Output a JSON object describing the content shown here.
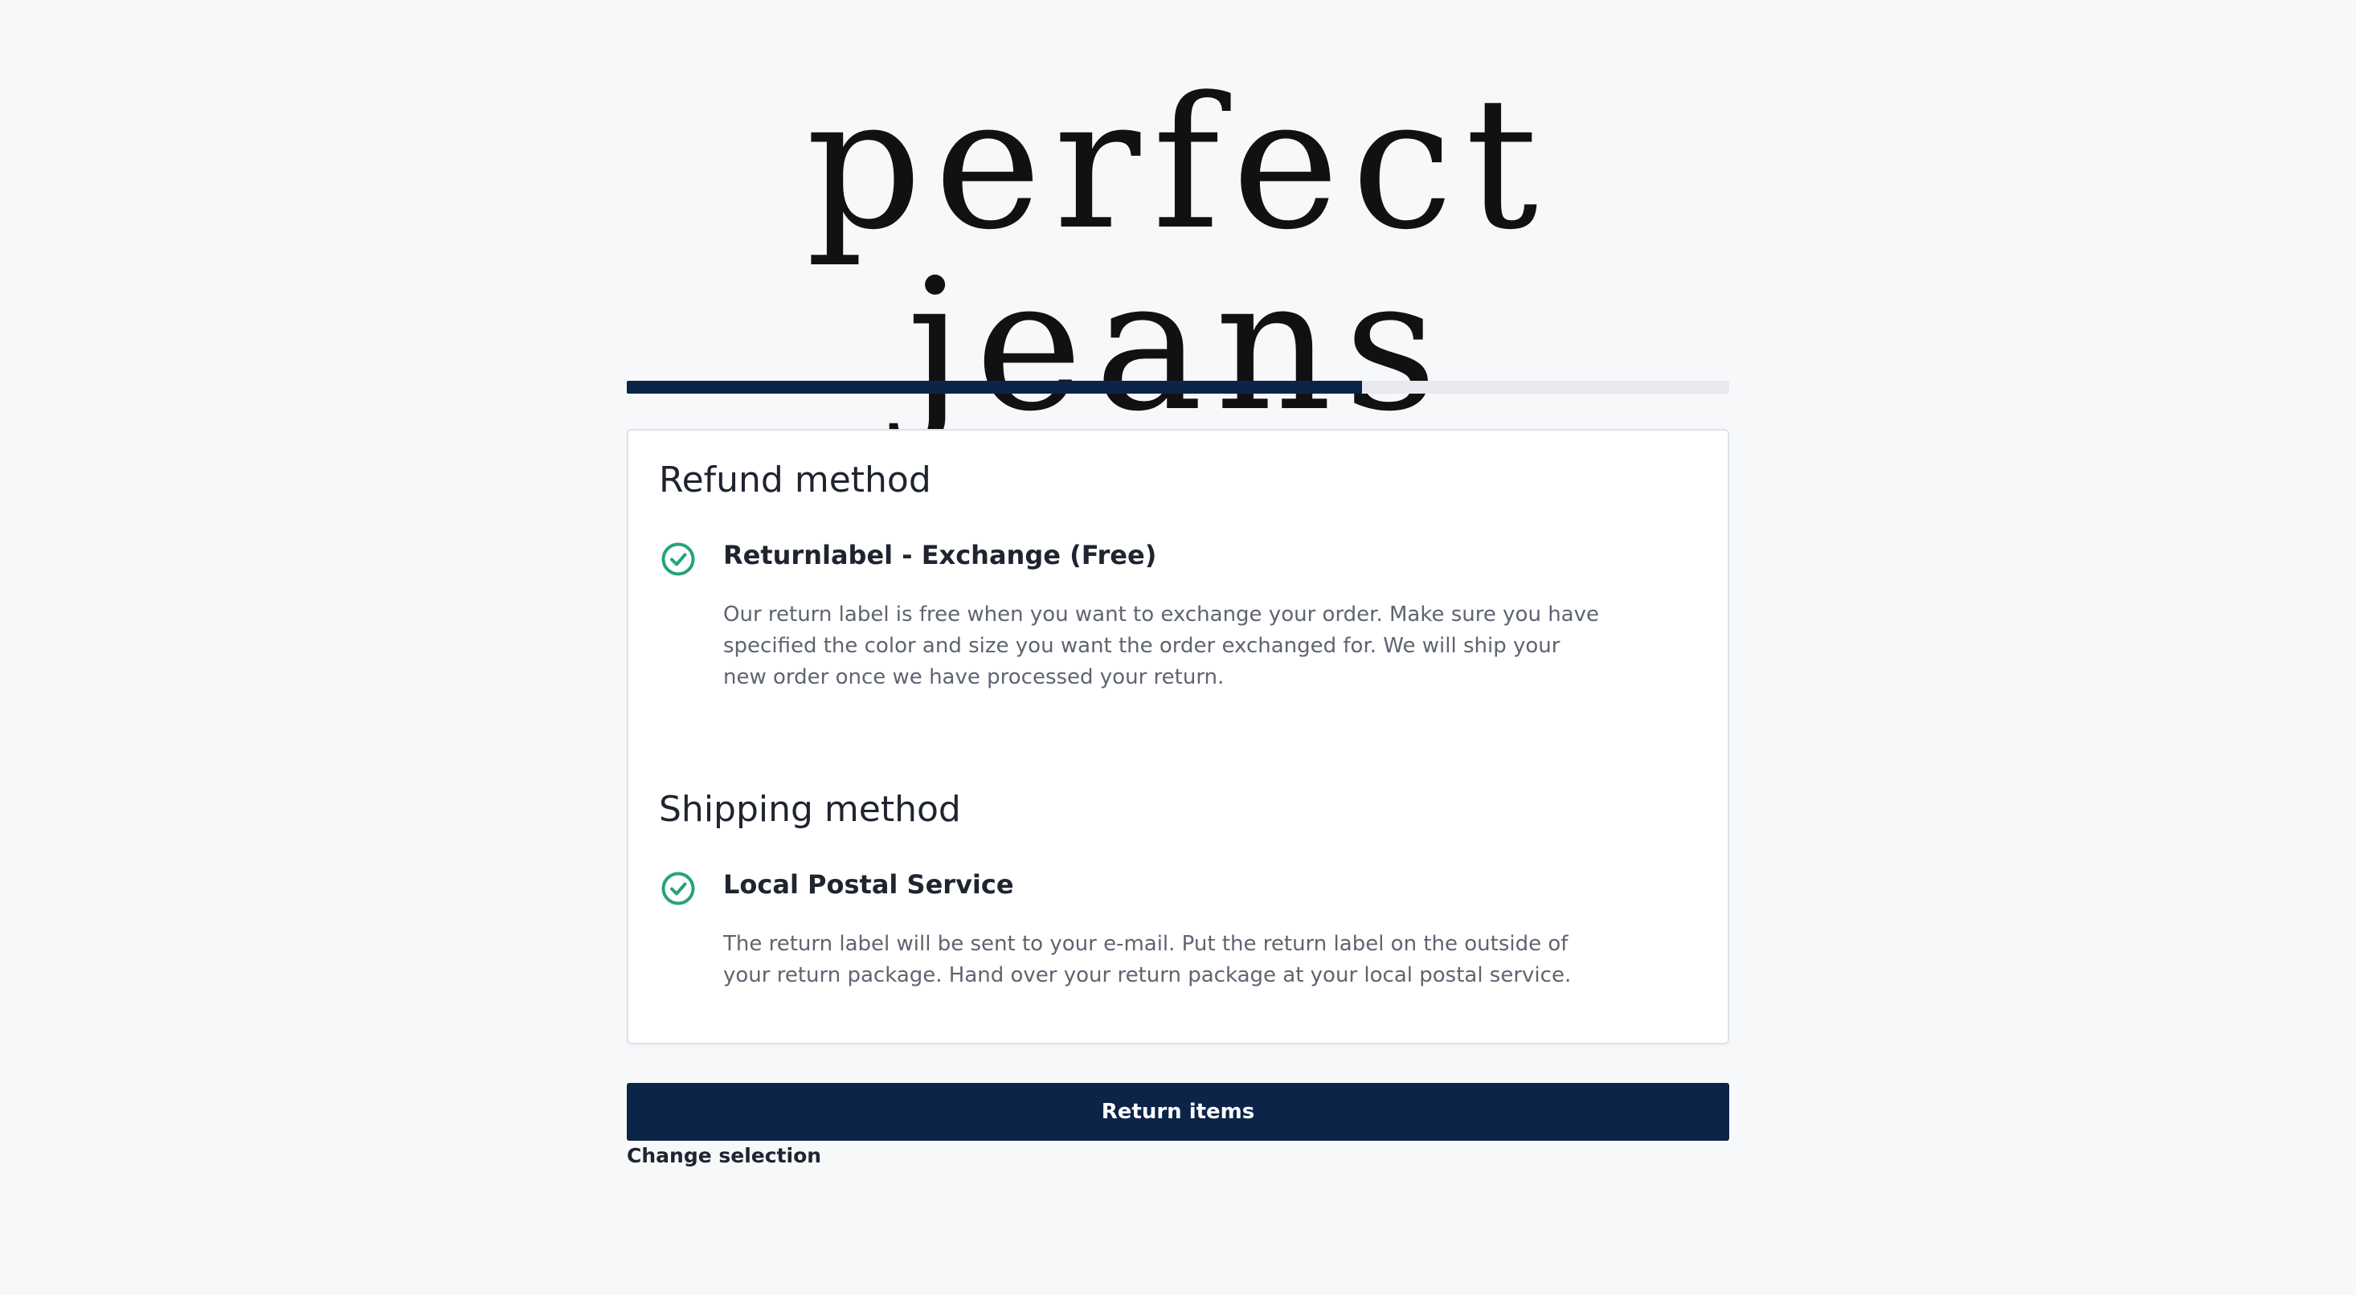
{
  "brand": {
    "logo_text": "perfect jeans"
  },
  "progress": {
    "fraction": 0.667
  },
  "refund": {
    "title": "Refund method",
    "option_title": "Returnlabel - Exchange (Free)",
    "option_description": "Our return label is free when you want to exchange your order. Make sure you have specified the color and size you want the order exchanged for. We will ship your new order once we have processed your return.",
    "icon": "check-circle-icon"
  },
  "shipping": {
    "title": "Shipping method",
    "option_title": "Local Postal Service",
    "option_description": "The return label will be sent to your e-mail. Put the return label on the outside of your return package. Hand over your return package at your local postal service.",
    "icon": "check-circle-icon"
  },
  "actions": {
    "primary_label": "Return items",
    "secondary_label": "Change selection"
  },
  "colors": {
    "primary": "#0c2448",
    "check": "#26a37a",
    "background": "#f7f8fa"
  }
}
